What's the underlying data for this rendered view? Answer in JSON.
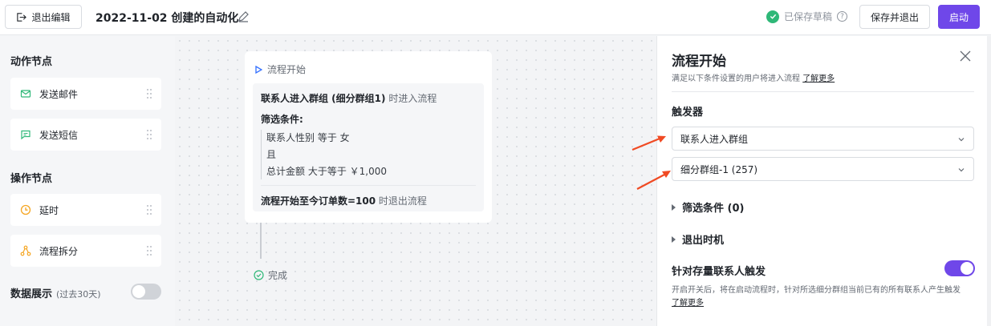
{
  "topbar": {
    "exit_edit": "退出编辑",
    "flow_title": "2022-11-02 创建的自动化",
    "saved_status": "已保存草稿",
    "save_and_exit": "保存并退出",
    "start": "启动"
  },
  "sidebar": {
    "action_nodes_title": "动作节点",
    "action_nodes": [
      {
        "label": "发送邮件",
        "icon": "mail-icon"
      },
      {
        "label": "发送短信",
        "icon": "sms-icon"
      }
    ],
    "operation_nodes_title": "操作节点",
    "operation_nodes": [
      {
        "label": "延时",
        "icon": "clock-icon"
      },
      {
        "label": "流程拆分",
        "icon": "split-icon"
      }
    ],
    "data_display_title": "数据展示",
    "data_display_sub": "(过去30天)",
    "data_display_enabled": false
  },
  "canvas": {
    "start_label": "流程开始",
    "trigger_bold": "联系人进入群组 (细分群组1)",
    "trigger_suffix": " 时进入流程",
    "filter_label": "筛选条件:",
    "conditions": [
      "联系人性别 等于 女",
      "且",
      "总计金额 大于等于 ￥1,000"
    ],
    "exit_bold": "流程开始至今订单数=100",
    "exit_suffix": " 时退出流程",
    "done_label": "完成"
  },
  "panel": {
    "title": "流程开始",
    "desc": "满足以下条件设置的用户将进入流程",
    "learn_more": "了解更多",
    "trigger_title": "触发器",
    "trigger_select": "联系人进入群组",
    "segment_select": "细分群组-1 (257)",
    "filter_conditions": "筛选条件 (0)",
    "exit_timing": "退出时机",
    "existing_contacts_title": "针对存量联系人触发",
    "existing_contacts_enabled": true,
    "existing_note": "开启开关后，将在启动流程时，针对所选细分群组当前已有的所有联系人产生触发",
    "note_learn_more": "了解更多"
  },
  "colors": {
    "accent": "#6f47e9",
    "success": "#2fb878",
    "annotation_arrow": "#f04a23"
  }
}
